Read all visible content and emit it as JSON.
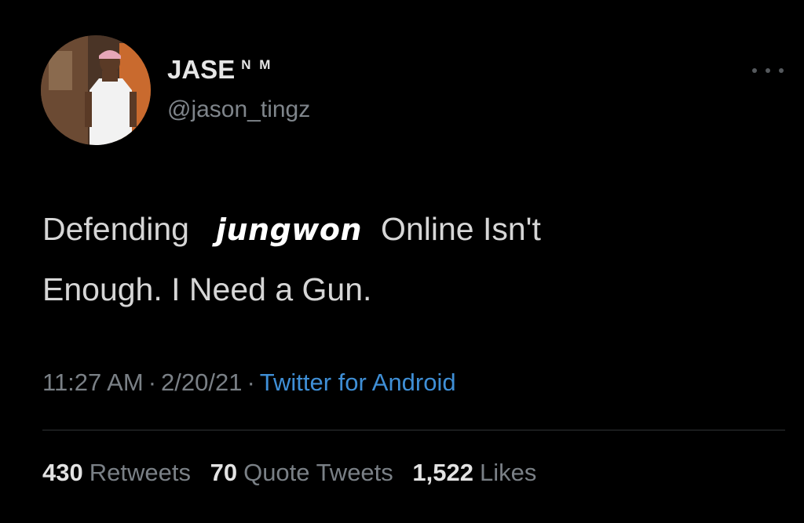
{
  "user": {
    "display_name": "JASE",
    "name_badge": "N M",
    "handle": "@jason_tingz"
  },
  "tweet": {
    "text_part1": "Defending",
    "censored_name": "jungwon",
    "text_part2": "Online Isn't",
    "text_line2": "Enough. I Need a Gun."
  },
  "meta": {
    "time": "11:27 AM",
    "sep": "·",
    "date": "2/20/21",
    "source": "Twitter for Android"
  },
  "stats": {
    "retweets_count": "430",
    "retweets_label": "Retweets",
    "quotes_count": "70",
    "quotes_label": "Quote Tweets",
    "likes_count": "1,522",
    "likes_label": "Likes"
  },
  "colors": {
    "background": "#000000",
    "link": "#3f8fd6",
    "muted": "#7a8086"
  },
  "icons": {
    "more": "more-horizontal-icon"
  }
}
